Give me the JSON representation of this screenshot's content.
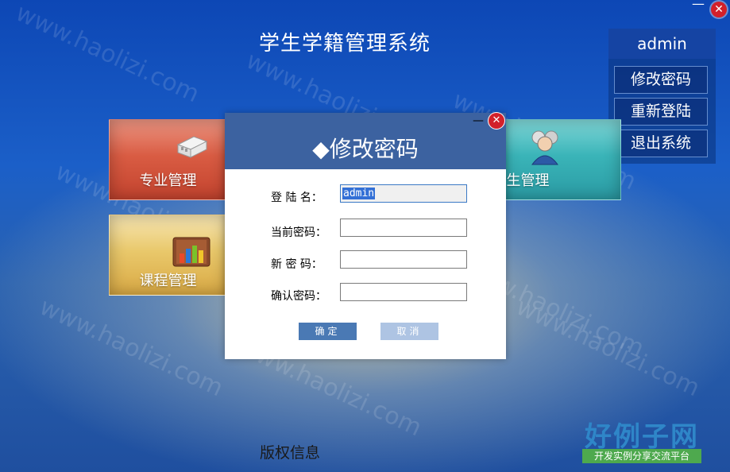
{
  "app": {
    "title": "学生学籍管理系统"
  },
  "window": {
    "minimize": "—",
    "close": "✕"
  },
  "user": {
    "name": "admin"
  },
  "menu": [
    "修改密码",
    "重新登陆",
    "退出系统"
  ],
  "tiles": {
    "major": "专业管理",
    "course": "课程管理",
    "student": "学生管理"
  },
  "footer": {
    "copyright": "版权信息"
  },
  "logo": {
    "title": "好例子网",
    "subtitle": "开发实例分享交流平台"
  },
  "watermark": "www.haolizi.com",
  "dialog": {
    "title": "◆修改密码",
    "minimize": "—",
    "close": "✕",
    "fields": [
      {
        "label": "登 陆 名：",
        "value": "admin"
      },
      {
        "label": "当前密码：",
        "value": ""
      },
      {
        "label": "新 密 码：",
        "value": ""
      },
      {
        "label": "确认密码：",
        "value": ""
      }
    ],
    "ok_label": "确定",
    "cancel_label": "取消"
  },
  "colors": {
    "background": "#1b5fc8",
    "dialog_header": "#3c62a0",
    "close_red": "#d2202a",
    "logo_green": "#4ea94e",
    "logo_blue": "#2f86c8"
  }
}
